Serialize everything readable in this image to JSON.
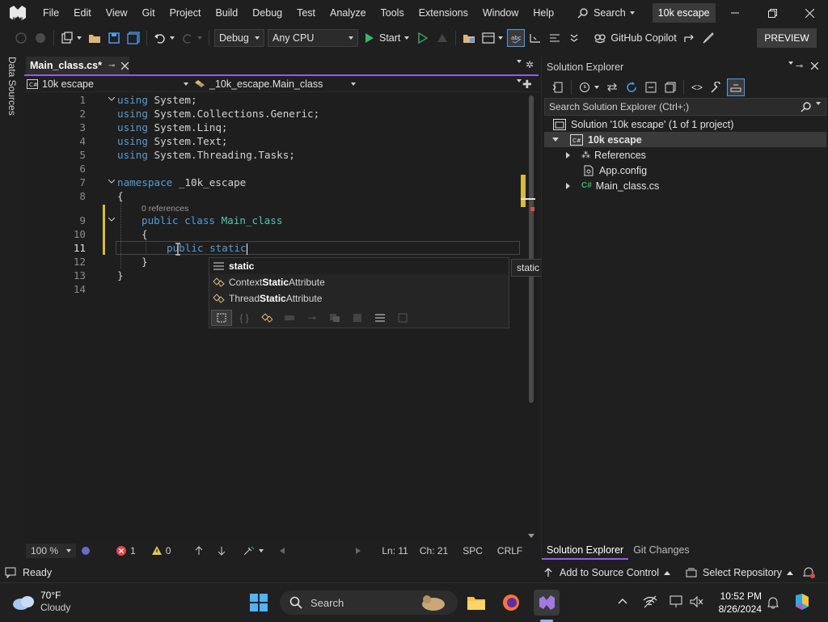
{
  "menu": [
    "File",
    "Edit",
    "View",
    "Git",
    "Project",
    "Build",
    "Debug",
    "Test",
    "Analyze",
    "Tools",
    "Extensions",
    "Window",
    "Help"
  ],
  "search_label": "Search",
  "solution_name": "10k escape",
  "toolbar": {
    "config": "Debug",
    "platform": "Any CPU",
    "start": "Start",
    "copilot": "GitHub Copilot",
    "preview": "PREVIEW"
  },
  "left_tab": "Data Sources",
  "editor": {
    "tab_label": "Main_class.cs*",
    "nav_project": "10k escape",
    "nav_class": "_10k_escape.Main_class",
    "references_lens": "0 references",
    "zoom": "100 %",
    "errors": "1",
    "warnings": "0",
    "ln": "Ln: 11",
    "ch": "Ch: 21",
    "spc": "SPC",
    "crlf": "CRLF"
  },
  "code": {
    "lines": [
      "1",
      "2",
      "3",
      "4",
      "5",
      "6",
      "7",
      "8",
      "9",
      "10",
      "11",
      "12",
      "13",
      "14"
    ],
    "l1_kw": "using",
    "l1_rest": " System;",
    "l2_kw": "using",
    "l2_rest": " System.Collections.Generic;",
    "l3_kw": "using",
    "l3_rest": " System.Linq;",
    "l4_kw": "using",
    "l4_rest": " System.Text;",
    "l5_kw": "using",
    "l5_rest": " System.Threading.Tasks;",
    "l7_kw": "namespace",
    "l7_rest": " _10k_escape",
    "l8": "{",
    "l9_kw": "public class",
    "l9_type": "Main_class",
    "l10": "{",
    "l11_kw": "public static",
    "l12": "}",
    "l13": "}"
  },
  "autocomplete": {
    "items": [
      {
        "pre": "",
        "bold": "static",
        "post": ""
      },
      {
        "pre": "Context",
        "bold": "Static",
        "post": "Attribute"
      },
      {
        "pre": "Thread",
        "bold": "Static",
        "post": "Attribute"
      }
    ],
    "tooltip": "static Keyword"
  },
  "solution_explorer": {
    "title": "Solution Explorer",
    "search_placeholder": "Search Solution Explorer (Ctrl+;)",
    "solution": "Solution '10k escape' (1 of 1 project)",
    "project": "10k escape",
    "references": "References",
    "appconfig": "App.config",
    "mainclass": "Main_class.cs",
    "tab1": "Solution Explorer",
    "tab2": "Git Changes"
  },
  "statusbar": {
    "ready": "Ready",
    "add_source": "Add to Source Control",
    "select_repo": "Select Repository"
  },
  "taskbar": {
    "temp": "70°F",
    "weather": "Cloudy",
    "search": "Search",
    "time": "10:52 PM",
    "date": "8/26/2024"
  }
}
